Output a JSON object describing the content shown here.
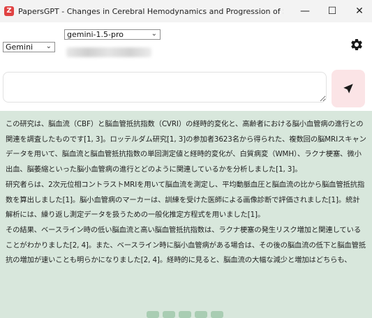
{
  "window": {
    "logo": "Z",
    "title": "PapersGPT - Changes in Cerebral Hemodynamics and Progression of Subclinical Vascul...",
    "minimize_glyph": "—",
    "maximize_glyph": "☐",
    "close_glyph": "✕"
  },
  "toolbar": {
    "provider": "Gemini",
    "model": "gemini-1.5-pro",
    "settings_icon": "gear-icon"
  },
  "prompt": {
    "placeholder": "",
    "send_icon": "send-icon"
  },
  "response": {
    "paragraphs": [
      "この研究は、脳血流（CBF）と脳血管抵抗指数（CVRI）の経時的変化と、高齢者における脳小血管病の進行との関連を調査したものです[1, 3]。ロッテルダム研究[1, 3]の参加者3623名から得られた、複数回の脳MRIスキャンデータを用いて、脳血流と脳血管抵抗指数の単回測定値と経時的変化が、白質病変（WMH）、ラクナ梗塞、微小出血、脳萎縮といった脳小血管病の進行とどのように関連しているかを分析しました[1, 3]。",
      "研究者らは、2次元位相コントラストMRIを用いて脳血流を測定し、平均動脈血圧と脳血流の比から脳血管抵抗指数を算出しました[1]。脳小血管病のマーカーは、訓練を受けた医師による画像診断で評価されました[1]。統計解析には、繰り返し測定データを扱うための一般化推定方程式を用いました[1]。",
      "その結果、ベースライン時の低い脳血流と高い脳血管抵抗指数は、ラクナ梗塞の発生リスク増加と関連していることがわかりました[2, 4]。また、ベースライン時に脳小血管病がある場合は、その後の脳血流の低下と脳血管抵抗の増加が速いことも明らかになりました[2, 4]。経時的に見ると、脳血流の大幅な減少と増加はどちらも、"
    ]
  },
  "colors": {
    "response_bg": "#d8e7dc",
    "send_bg": "#fbe4e6",
    "app_logo": "#e04242"
  }
}
